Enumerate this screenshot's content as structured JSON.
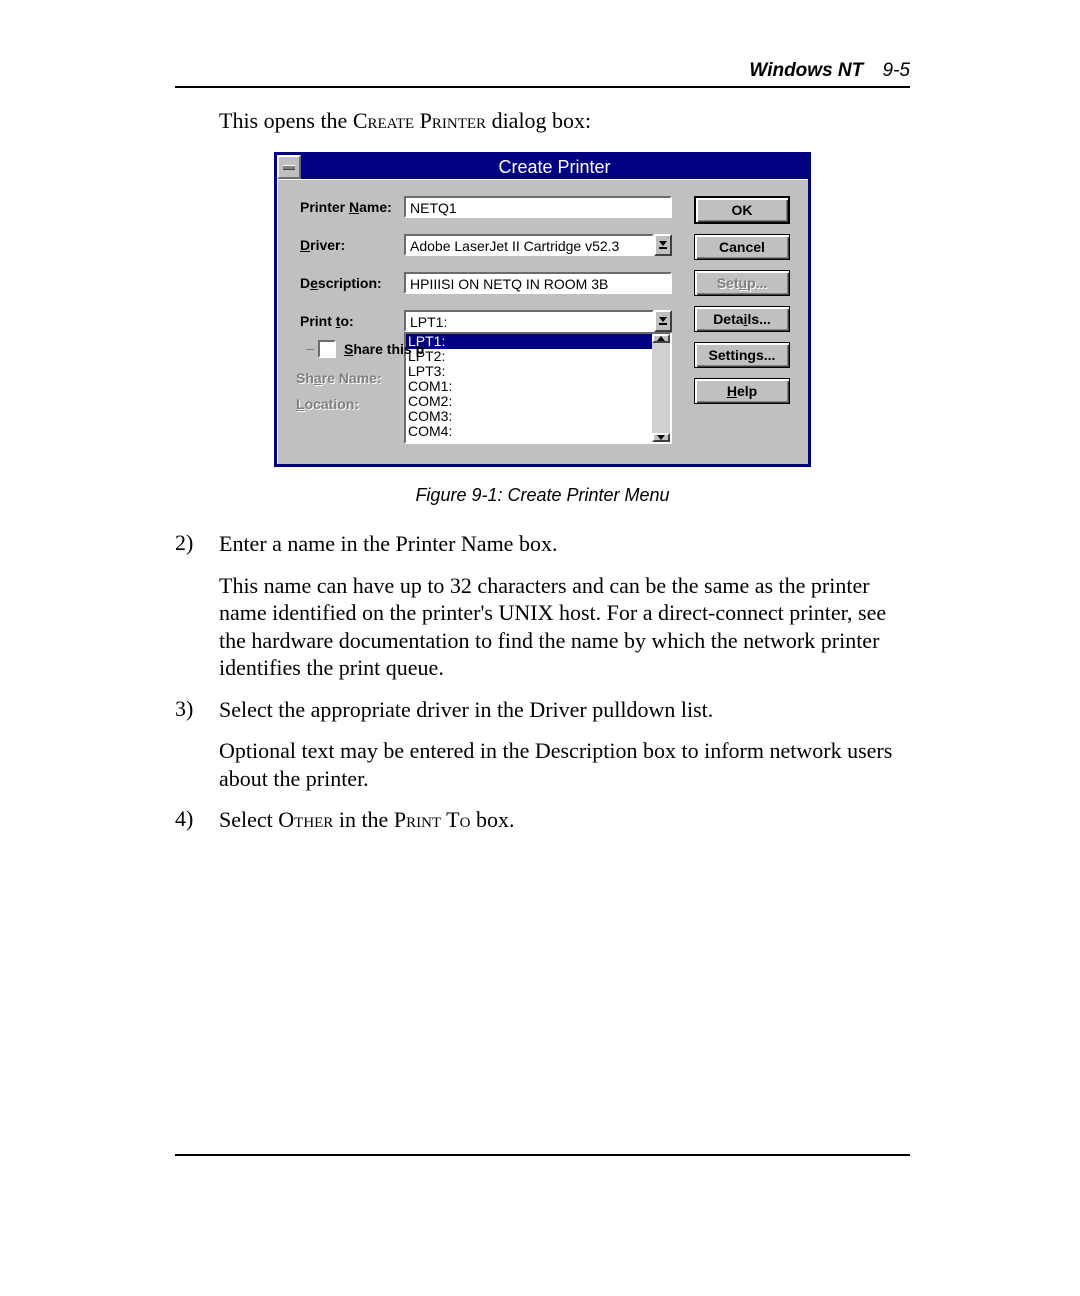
{
  "header": {
    "title": "Windows NT",
    "page": "9-5"
  },
  "intro": {
    "pre": "This opens the ",
    "dialog_name": "Create Printer",
    "post": " dialog box:"
  },
  "dialog": {
    "title": "Create Printer",
    "labels": {
      "printer_name": "Printer Name:",
      "driver": "Driver:",
      "description": "Description:",
      "print_to": "Print to:",
      "share_this": "Share this p",
      "share_name": "Share Name:",
      "location": "Location:"
    },
    "underline_ix": {
      "printer_name": "N",
      "driver": "D",
      "description": "e",
      "print_to": "t",
      "share_this": "S",
      "share_name": "a",
      "location": "L"
    },
    "fields": {
      "printer_name": "NETQ1",
      "driver": "Adobe LaserJet II Cartridge v52.3",
      "description": "HPIIISI ON NETQ IN ROOM 3B",
      "print_to": "LPT1:"
    },
    "port_options": [
      "LPT1:",
      "LPT2:",
      "LPT3:",
      "COM1:",
      "COM2:",
      "COM3:",
      "COM4:"
    ],
    "port_selected": "LPT1:",
    "buttons": {
      "ok": "OK",
      "cancel": "Cancel",
      "setup": "Setup...",
      "details": "Details...",
      "settings": "Settings...",
      "help": "Help"
    },
    "btn_under": {
      "setup": "u",
      "details": "i",
      "help": "H"
    }
  },
  "caption": "Figure 9-1:  Create Printer Menu",
  "steps": [
    {
      "head": "Enter a name in the Printer Name box.",
      "body": "This name can have up to 32 characters and can be the same as the printer name identified on the printer's UNIX host.  For a direct-connect printer, see the hardware documentation to find the name by which the network printer identifies the print queue."
    },
    {
      "head": "Select the appropriate driver in the Driver pulldown list.",
      "body": "Optional text may be entered in the Description box to inform network users about the printer."
    },
    {
      "head_pre": "Select ",
      "sc1": "Other",
      "head_mid": " in the ",
      "sc2": "Print To",
      "head_post": " box."
    }
  ]
}
